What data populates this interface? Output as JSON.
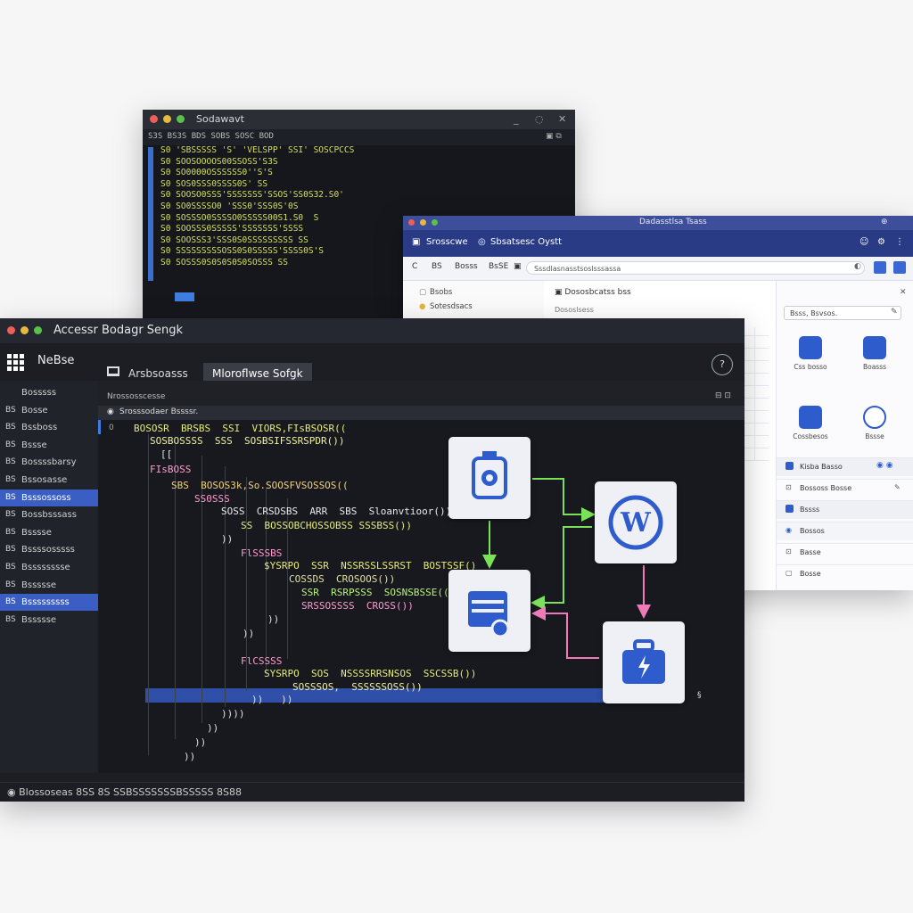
{
  "terminal": {
    "title": "Sodawavt",
    "subtitle": "S3S BS3S  BDS  SOBS SOSC BOD",
    "lines": [
      "S0 'SBSSSSS 'S' 'VELSPP' SSI' SOSCPCCS",
      "S0 SOOSOOOOS00SSOSS'S3S",
      "S0 SO0000OSSSSSS0''S'S",
      "S0 SOS0SSS0SSSS0S' SS",
      "S0 SOOSO0SSS'SSSSSSS'SSOS'SS0S32.S0'",
      "S0 SO0SSSSO0 'SSS0'SSS0S'0S",
      "S0 SOSSSO0SSSSO0SSSSS00S1.S0  S",
      "S0 SOOSSS0SSSSS'SSSSSSS'SSSS",
      "S0 SOOSSS3'SSS0S0SSSSSSSSS SS",
      "S0 SSSSSSSSSOSS0S0SSSSS'SSSS0S'S",
      "S0 SOSSS0S0S0S0S0SOSSS SS"
    ]
  },
  "browser": {
    "window_title": "Dadasstlsa Tsass",
    "tabs": [
      "Srosscwe",
      "Sbsatsesc Oystt"
    ],
    "toolbar": [
      "BS",
      "Bosss",
      "BsSE"
    ],
    "url": "Sssdlasnasstsoslsssassa",
    "sidebar": [
      "Bsobs",
      "Sotesdsacs"
    ],
    "main_head": "Dososbcatss bss",
    "main_sub": "Dososlsess",
    "search": "Bsss, Bsvsos.",
    "cards": [
      "Css bosso",
      "Boasss",
      "Cossbesos",
      "Bssse"
    ],
    "list": [
      "Kisba Basso",
      "Bossoss Bosse",
      "Bssss",
      "Bossos",
      "Basse",
      "Bosse"
    ]
  },
  "editor": {
    "window_title": "Accessr Bodagr Sengk",
    "brand": "NeBse",
    "tabs": [
      "Arsbsoasss",
      "Mloroflwse Sofgk"
    ],
    "active_tab": 1,
    "path": "Nrossosscesse",
    "file": "Srosssodaer Bssssr.",
    "sidebar": [
      {
        "icon": "",
        "label": "Bosssss"
      },
      {
        "icon": "BS",
        "label": "Bosse"
      },
      {
        "icon": "BS",
        "label": "Bssboss"
      },
      {
        "icon": "BS",
        "label": "Bssse"
      },
      {
        "icon": "BS",
        "label": "Bossssbarsy"
      },
      {
        "icon": "BS",
        "label": "Bssosasse"
      },
      {
        "icon": "BS",
        "label": "Bsssossoss"
      },
      {
        "icon": "BS",
        "label": "Bossbsssass"
      },
      {
        "icon": "BS",
        "label": "Bsssse"
      },
      {
        "icon": "BS",
        "label": "Bssssosssss"
      },
      {
        "icon": "BS",
        "label": "Bsssssssse"
      },
      {
        "icon": "BS",
        "label": "Bssssse"
      },
      {
        "icon": "BS",
        "label": "Bsssssssss"
      },
      {
        "icon": "BS",
        "label": "Bssssse"
      }
    ],
    "code": [
      {
        "text": "BOSOSR  BRSBS  SSI  VIORS,FIsBSOSR((",
        "color": "#e7e97a"
      },
      {
        "text": "SOSBOSSSS  SSS  SOSBSIFSSRSPDR())",
        "color": "#f0f0a0"
      },
      {
        "text": "[[",
        "color": "#e0e0e0"
      },
      {
        "text": "FIsBOSS",
        "color": "#ff9ad0"
      },
      {
        "text": "SBS  BOSOS3k,So.SOOSFVSOSSOS((",
        "color": "#f0d080"
      },
      {
        "text": "SS0SSS",
        "color": "#ff9ad0"
      },
      {
        "text": "SOSS  CRSDSBS  ARR  SBS  Sloanvtioor())",
        "color": "#eaeaea"
      },
      {
        "text": "SS  BOSSOBCHOSSOBSS SSSBSS())",
        "color": "#e7e97a"
      },
      {
        "text": "))",
        "color": "#e0e0e0"
      },
      {
        "text": "FlSSSBS",
        "color": "#ff9ad0"
      },
      {
        "text": "$YSRPO  SSR  NSSRSSLSSRST  BOSTSSF()",
        "color": "#e7e97a"
      },
      {
        "text": "COSSDS  CROSOOS())",
        "color": "#e0e0a0"
      },
      {
        "text": "SSR  RSRPSSS  SOSNSBSSE(()",
        "color": "#b8f07a"
      },
      {
        "text": "SRSSOSSSS  CROSS())",
        "color": "#ff9ad0"
      },
      {
        "text": "))",
        "color": "#e0e0e0"
      },
      {
        "text": "))",
        "color": "#e0e0e0"
      },
      {
        "text": "FlCSSSS",
        "color": "#ff9ad0"
      },
      {
        "text": "SYSRPO  SOS  NSSSSRRSNSOS  SSCSSB())",
        "color": "#e7e97a"
      },
      {
        "text": "SOSSSOS,  SSSSSSOSS())",
        "color": "#f0f0a0"
      },
      {
        "text": "))   ))",
        "color": "#e0e0e0"
      },
      {
        "text": "))))",
        "color": "#e0e0e0"
      },
      {
        "text": "))",
        "color": "#e0e0e0"
      },
      {
        "text": "))",
        "color": "#e0e0e0"
      },
      {
        "text": "))",
        "color": "#e0e0e0"
      }
    ],
    "status": "Blossoseas  8SS  8S  SSBSSSSSSSBSSSSS  8S88"
  }
}
